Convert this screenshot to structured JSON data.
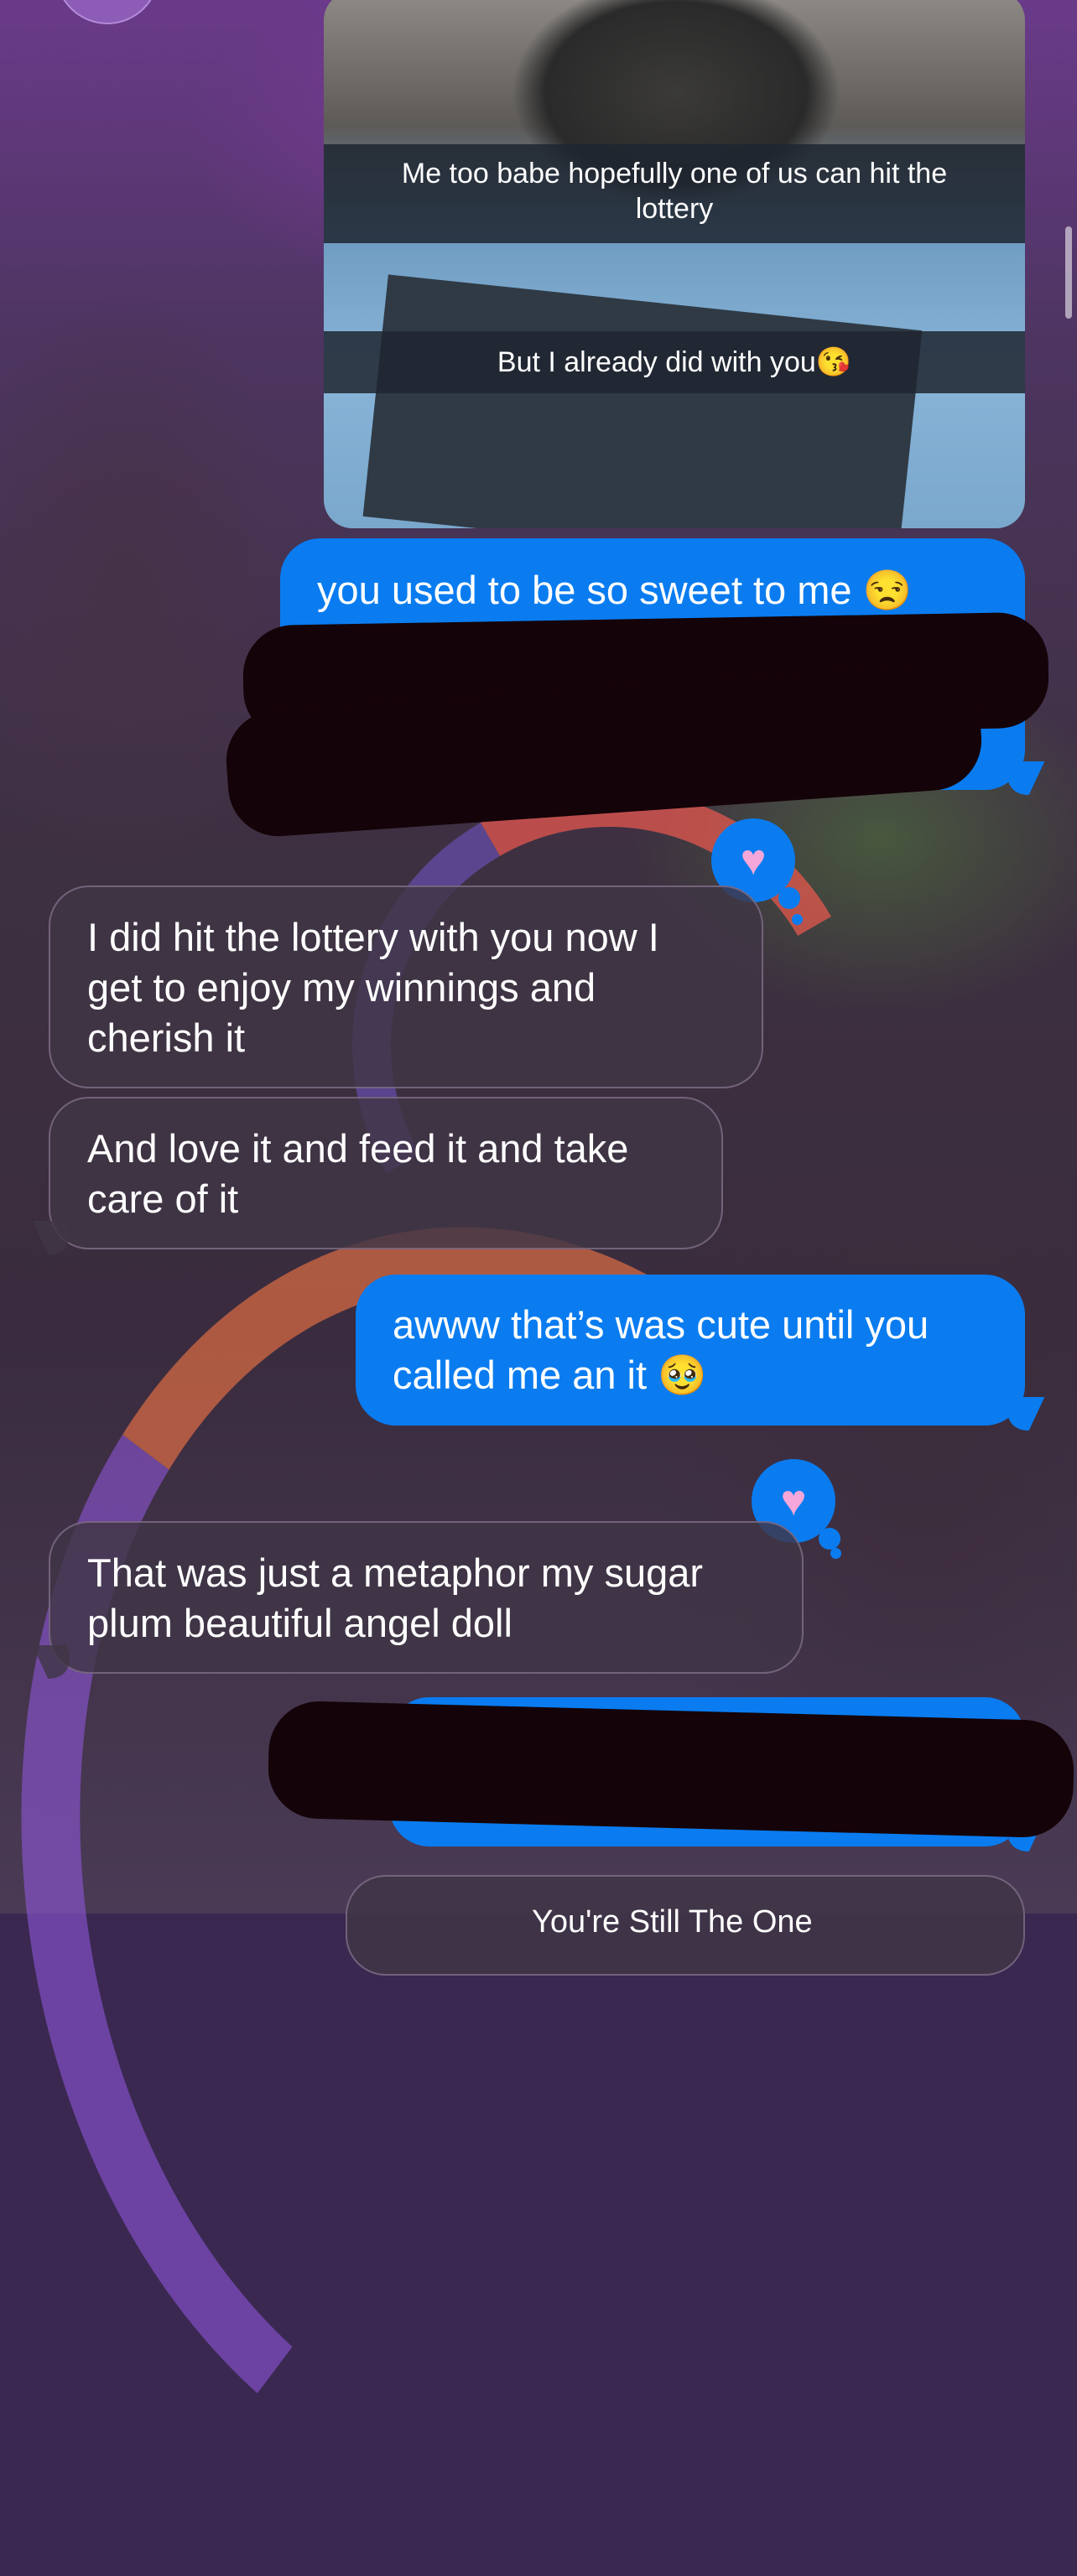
{
  "conversation": {
    "photo": {
      "caption_1": "Me too babe hopefully one of us can hit the lottery",
      "caption_2": "But I already did with you😘"
    },
    "messages": [
      {
        "from": "me",
        "text": "you used to be so sweet to me 😒"
      },
      {
        "from": "them",
        "text": "I did hit the lottery with you now I get to enjoy my winnings and cherish it",
        "reaction": "♥"
      },
      {
        "from": "them",
        "text": "And love it and feed it and take care of it"
      },
      {
        "from": "me",
        "text": "awww that’s was cute until you called me an it 🥹"
      },
      {
        "from": "them",
        "text": "That was just a metaphor my sugar plum beautiful angel doll",
        "reaction": "♥"
      }
    ],
    "bottom_partial_text": "You're Still The One"
  },
  "colors": {
    "sent_bubble": "#0a7cf0",
    "received_bubble": "#403646",
    "redaction": "#140308",
    "reaction_heart": "#f4a7d8"
  }
}
